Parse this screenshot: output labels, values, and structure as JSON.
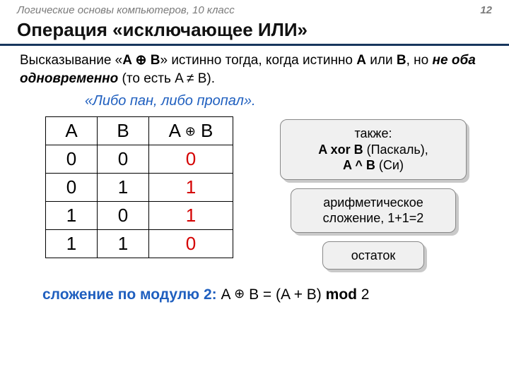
{
  "header": {
    "left": "Логические основы компьютеров, 10 класс",
    "page": "12"
  },
  "title": "Операция «исключающее ИЛИ»",
  "desc_parts": {
    "p1": "Высказывание «",
    "p2": "A ⊕ B",
    "p3": "» истинно тогда, когда истинно ",
    "p4": "A",
    "p5": " или ",
    "p6": "B",
    "p7": ", но ",
    "p8": "не оба одновременно",
    "p9": " (то есть A ≠ B)."
  },
  "quote": "«Либо пан, либо пропал».",
  "table": {
    "head": {
      "a": "A",
      "b": "B",
      "ab_pre": "A ",
      "ab_op": "⊕",
      "ab_post": " B"
    },
    "rows": [
      {
        "a": "0",
        "b": "0",
        "r": "0"
      },
      {
        "a": "0",
        "b": "1",
        "r": "1"
      },
      {
        "a": "1",
        "b": "0",
        "r": "1"
      },
      {
        "a": "1",
        "b": "1",
        "r": "0"
      }
    ]
  },
  "bubbles": {
    "b1_l1": "также:",
    "b1_l2_pre": "A xor B",
    "b1_l2_post": " (Паскаль),",
    "b1_l3_pre": "A ^ B",
    "b1_l3_post": " (Си)",
    "b2": "арифметическое сложение, 1+1=2",
    "b3": "остаток"
  },
  "footer": {
    "label": "сложение по модулю 2:",
    "expr_pre": "  A ",
    "expr_op": "⊕",
    "expr_mid": " B = (A + B) ",
    "expr_mod": "mod",
    "expr_post": " 2"
  }
}
